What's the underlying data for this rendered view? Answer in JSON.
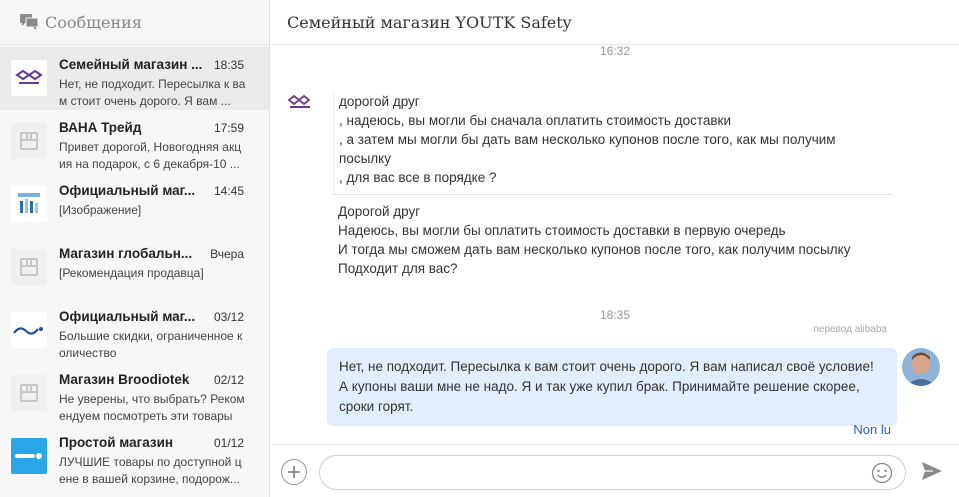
{
  "sidebar": {
    "title": "Сообщения",
    "conversations": [
      {
        "name": "Семейный магазин ...",
        "time": "18:35",
        "preview": "Нет, не подходит. Пересылка к вам стоит очень дорого. Я вам ...",
        "avatar": "youtk-logo",
        "active": true
      },
      {
        "name": "ВАНА Трейд",
        "time": "17:59",
        "preview": "Привет дорогой, Новогодняя акция на подарок, с 6 декабря-10 ...",
        "avatar": "store-icon"
      },
      {
        "name": "Официальный маг...",
        "time": "14:45",
        "preview": "[Изображение]",
        "avatar": "guaded-logo"
      },
      {
        "name": "Магазин глобальн...",
        "time": "Вчера",
        "preview": "[Рекомендация продавца]",
        "avatar": "store-icon"
      },
      {
        "name": "Официальный маг...",
        "time": "03/12",
        "preview": "Большие скидки, ограниченное количество",
        "avatar": "sonifer-logo"
      },
      {
        "name": "Магазин Broodiotek",
        "time": "02/12",
        "preview": "Не уверены, что выбрать? Рекомендуем посмотреть эти товары",
        "avatar": "store-icon"
      },
      {
        "name": "Простой магазин",
        "time": "01/12",
        "preview": "ЛУЧШИЕ товары по доступной цене в вашей корзине, подорож...",
        "avatar": "prosto-logo"
      }
    ]
  },
  "main": {
    "title": "Семейный магазин YOUTK Safety",
    "timestamp_top": "16:32",
    "incoming": {
      "original_lines": [
        "дорогой друг",
        ", надеюсь, вы могли бы сначала оплатить стоимость доставки",
        ", а затем мы могли бы дать вам несколько купонов после того, как мы получим посылку",
        ", для вас все в порядке ?"
      ],
      "translated_lines": [
        "Дорогой друг",
        "Надеюсь, вы могли бы оплатить стоимость доставки в первую очередь",
        "И тогда мы сможем дать вам несколько купонов после того, как получим посылку",
        "Подходит для вас?"
      ],
      "translation_label": "перевод alibaba"
    },
    "timestamp_mid": "18:35",
    "outgoing": {
      "text": "Нет, не подходит. Пересылка к вам стоит очень дорого. Я вам написал своё условие! А купоны ваши мне не надо. Я и так уже купил брак. Принимайте решение скорее, сроки горят.",
      "status": "Non lu"
    }
  },
  "composer": {
    "placeholder": ""
  },
  "colors": {
    "accent_blue": "#2a5fc7",
    "bubble_bg": "#e2eefb",
    "sidebar_bg": "#f7f7f7",
    "active_bg": "#ebebeb"
  }
}
